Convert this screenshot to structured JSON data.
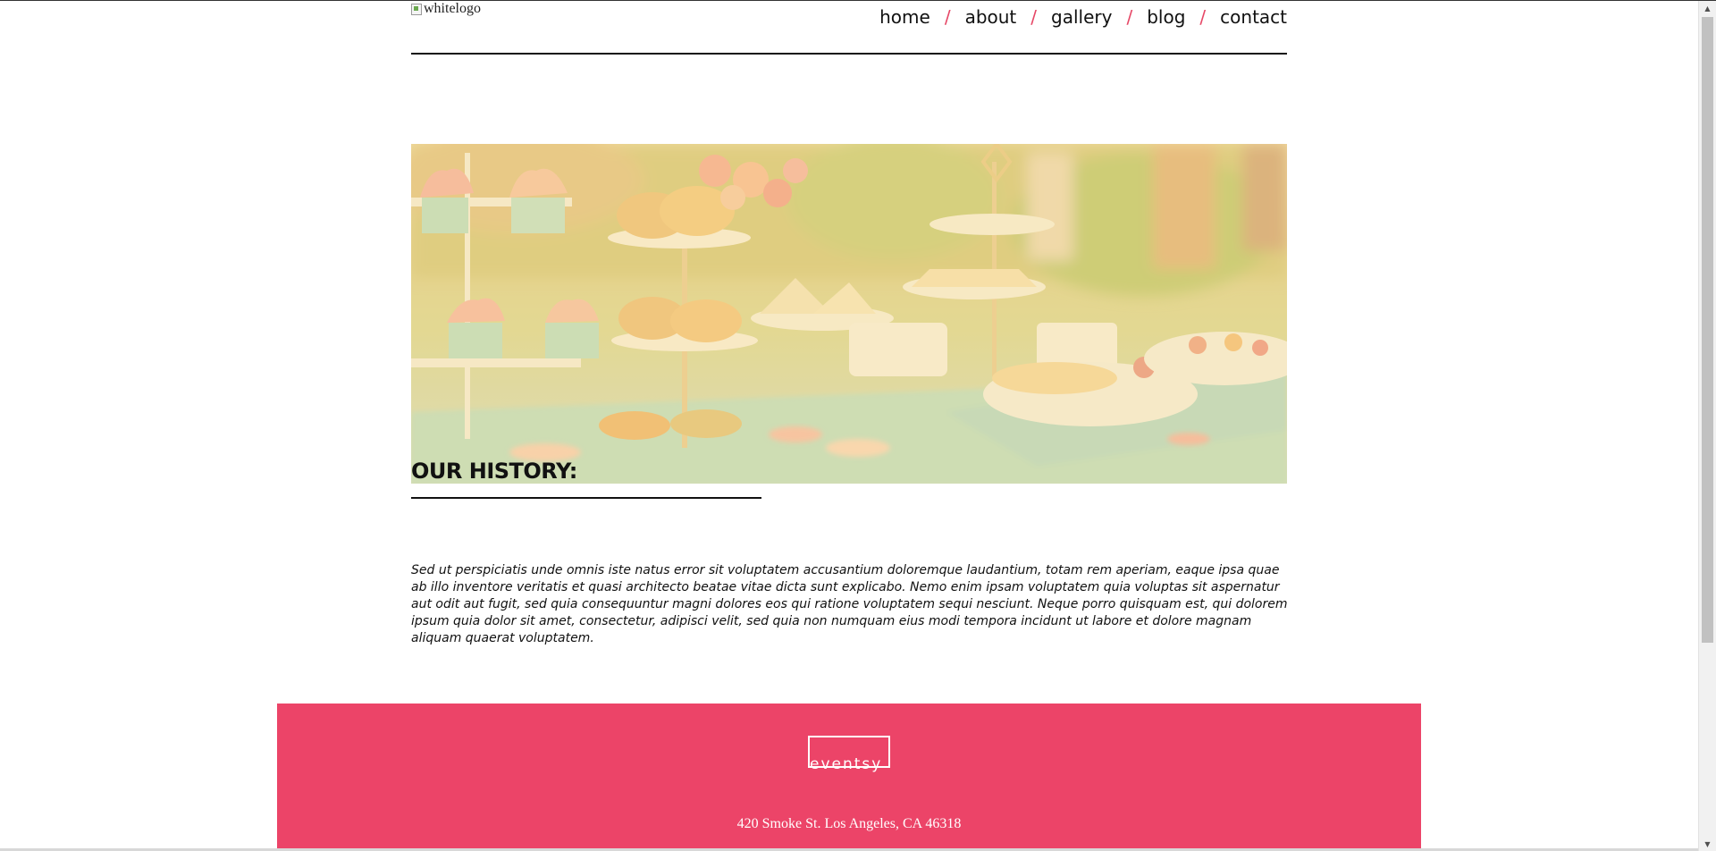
{
  "header": {
    "logo_alt": "whitelogo",
    "nav": [
      {
        "label": "home"
      },
      {
        "label": "about"
      },
      {
        "label": "gallery"
      },
      {
        "label": "blog"
      },
      {
        "label": "contact"
      }
    ],
    "separator": "/"
  },
  "hero": {
    "title": "OUR HISTORY:"
  },
  "history": {
    "text": "Sed ut perspiciatis unde omnis iste natus error sit voluptatem accusantium doloremque laudantium, totam rem aperiam, eaque ipsa quae ab illo inventore veritatis et quasi architecto beatae vitae dicta sunt explicabo. Nemo enim ipsam voluptatem quia voluptas sit aspernatur aut odit aut fugit, sed quia consequuntur magni dolores eos qui ratione voluptatem sequi nesciunt. Neque porro quisquam est, qui dolorem ipsum quia dolor sit amet, consectetur, adipisci velit, sed quia non numquam eius modi tempora incidunt ut labore et dolore magnam aliquam quaerat voluptatem."
  },
  "footer": {
    "logo_text": "eventsy",
    "address": "420 Smoke St. Los Angeles, CA 46318"
  },
  "colors": {
    "accent": "#ec4468",
    "separator": "#e64766",
    "text": "#111111"
  },
  "icons": {
    "broken_image": "broken-image-icon",
    "scroll_up": "scroll-up-arrow-icon",
    "scroll_down": "scroll-down-arrow-icon"
  }
}
